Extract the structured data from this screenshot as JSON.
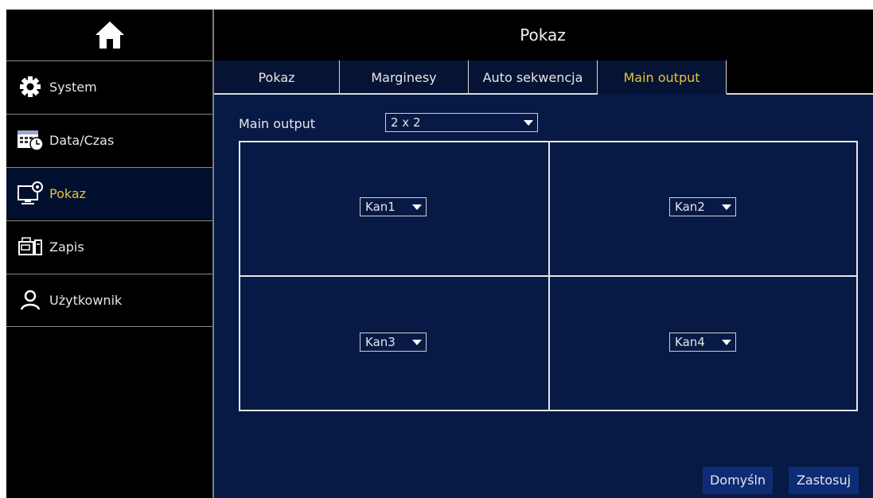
{
  "header": {
    "title": "Pokaz"
  },
  "sidebar": {
    "items": [
      {
        "label": "System",
        "icon": "gear-icon"
      },
      {
        "label": "Data/Czas",
        "icon": "calendar-clock-icon"
      },
      {
        "label": "Pokaz",
        "icon": "monitor-settings-icon",
        "active": true
      },
      {
        "label": "Zapis",
        "icon": "recorder-icon"
      },
      {
        "label": "Użytkownik",
        "icon": "user-icon"
      }
    ]
  },
  "tabs": [
    {
      "label": "Pokaz"
    },
    {
      "label": "Marginesy"
    },
    {
      "label": "Auto sekwencja"
    },
    {
      "label": "Main output",
      "active": true
    }
  ],
  "main_output": {
    "label": "Main output",
    "layout_value": "2 x 2",
    "channels": [
      "Kan1",
      "Kan2",
      "Kan3",
      "Kan4"
    ]
  },
  "buttons": {
    "default_label": "Domyśln",
    "apply_label": "Zastosuj"
  },
  "colors": {
    "background": "#071a45",
    "active_text": "#e0c43a",
    "button": "#0d2c75"
  }
}
